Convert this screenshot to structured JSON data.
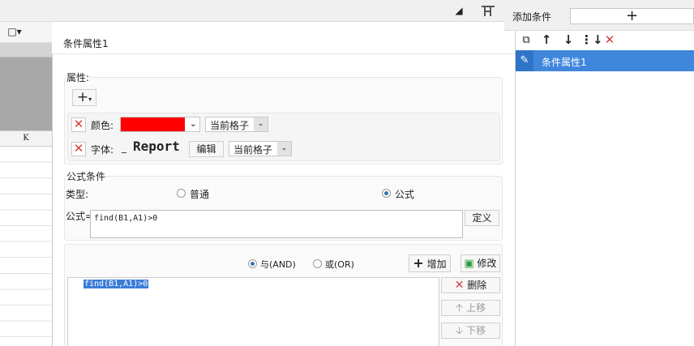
{
  "right_panel": {
    "title": "添加条件",
    "add_glyph": "+",
    "list_items": [
      "条件属性1"
    ]
  },
  "toolbar_icons": [
    "copy-icon",
    "arrow-up-icon",
    "arrow-down-icon",
    "move-bottom-icon",
    "delete-icon"
  ],
  "sheet": {
    "column_label": "K"
  },
  "dialog": {
    "title": "条件属性1",
    "property": {
      "section_label": "属性:",
      "add_glyph": "+",
      "color_label": "颜色:",
      "color_value": "#ff0000",
      "color_scope": "当前格子",
      "font_label": "字体:",
      "font_preview_prefix": "_",
      "font_preview": "Report",
      "edit_label": "编辑",
      "font_scope": "当前格子"
    },
    "formula_condition": {
      "section_label": "公式条件",
      "type_label": "类型:",
      "type_normal": "普通",
      "type_formula": "公式",
      "selected_type": "公式",
      "formula_label": "公式=",
      "formula_value": "find(B1,A1)>0",
      "define_label": "定义"
    },
    "logic": {
      "and_label": "与(AND)",
      "or_label": "或(OR)",
      "selected": "与(AND)",
      "add_label": "增加",
      "modify_label": "修改",
      "conditions": [
        "find(B1,A1)>0"
      ],
      "delete_label": "删除",
      "move_up_label": "上移",
      "move_down_label": "下移"
    }
  }
}
